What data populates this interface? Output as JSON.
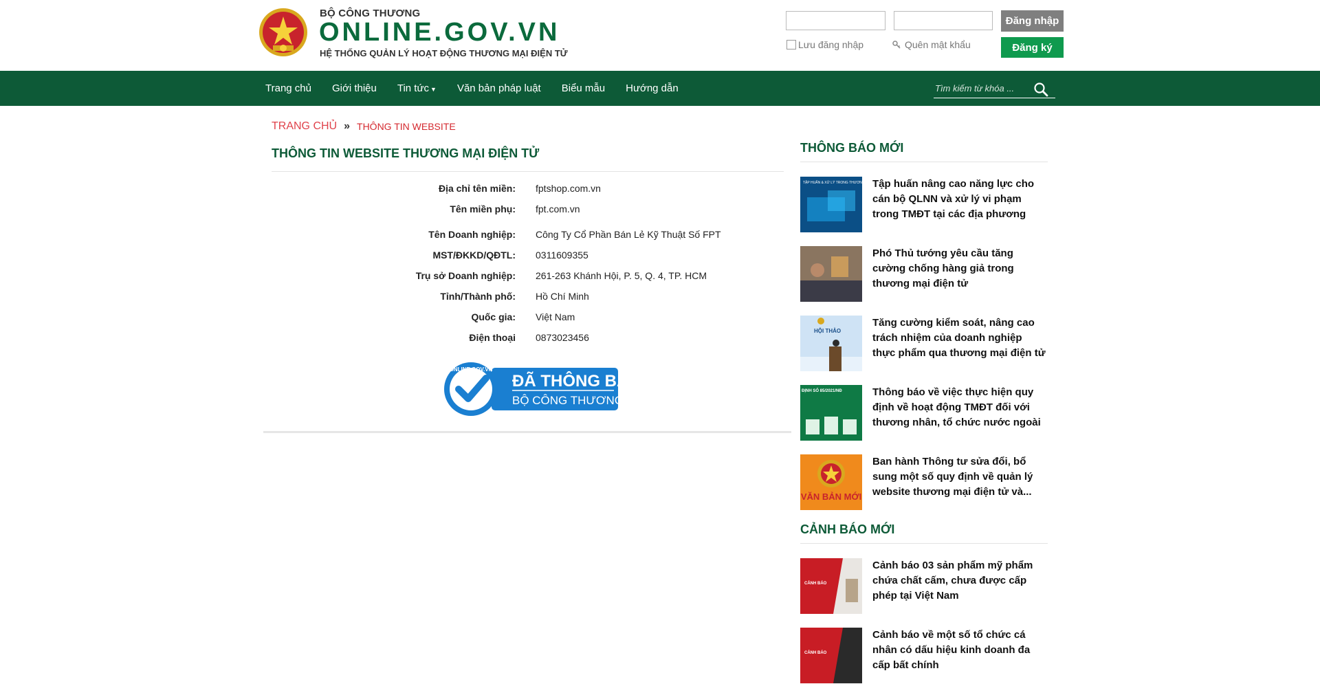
{
  "header": {
    "ministry": "BỘ CÔNG THƯƠNG",
    "site_name": "ONLINE.GOV.VN",
    "subtitle": "HỆ THỐNG QUẢN LÝ HOẠT ĐỘNG THƯƠNG MẠI ĐIỆN TỬ",
    "login_button": "Đăng nhập",
    "remember_label": "Lưu đăng nhập",
    "forgot_label": "Quên mật khẩu",
    "register_button": "Đăng ký",
    "username_value": "",
    "password_value": ""
  },
  "nav": {
    "items": [
      {
        "label": "Trang chủ"
      },
      {
        "label": "Giới thiệu"
      },
      {
        "label": "Tin tức"
      },
      {
        "label": "Văn bản pháp luật"
      },
      {
        "label": "Biểu mẫu"
      },
      {
        "label": "Hướng dẫn"
      }
    ],
    "search_placeholder": "Tìm kiếm từ khóa ...",
    "search_value": ""
  },
  "breadcrumb": {
    "home": "TRANG CHỦ",
    "separator": "»",
    "current": "THÔNG TIN WEBSITE"
  },
  "main": {
    "title": "THÔNG TIN WEBSITE THƯƠNG MẠI ĐIỆN TỬ",
    "fields": [
      {
        "label": "Địa chỉ tên miền:",
        "value": "fptshop.com.vn"
      },
      {
        "label": "Tên miền phụ:",
        "value": "fpt.com.vn"
      },
      {
        "label": "Tên Doanh nghiệp:",
        "value": "Công Ty Cổ Phần Bán Lẻ Kỹ Thuật Số FPT"
      },
      {
        "label": "MST/ĐKKD/QĐTL:",
        "value": "0311609355"
      },
      {
        "label": "Trụ sở Doanh nghiệp:",
        "value": "261-263 Khánh Hội, P. 5, Q. 4, TP. HCM"
      },
      {
        "label": "Tỉnh/Thành phố:",
        "value": "Hồ Chí Minh"
      },
      {
        "label": "Quốc gia:",
        "value": "Việt Nam"
      },
      {
        "label": "Điện thoại",
        "value": "0873023456"
      }
    ],
    "badge": {
      "circle_text": "ONLINE.GOV.VN",
      "line1": "ĐÃ THÔNG BÁO",
      "line2": "BỘ CÔNG THƯƠNG",
      "color": "#1a7fd1"
    }
  },
  "sidebar": {
    "notices_heading": "THÔNG BÁO MỚI",
    "notices": [
      {
        "title": "Tập huấn nâng cao năng lực cho cán bộ QLNN và xử lý vi phạm trong TMĐT tại các địa phương",
        "thumb_text": "TẬP HUẤN & XỬ LÝ TRONG THƯƠNG MẠI ĐIỆN TỬ"
      },
      {
        "title": "Phó Thủ tướng yêu cầu tăng cường chống hàng giả trong thương mại điện tử",
        "thumb_text": ""
      },
      {
        "title": "Tăng cường kiểm soát, nâng cao trách nhiệm của doanh nghiệp thực phẩm qua thương mại điện tử",
        "thumb_text": "HỘI THẢO"
      },
      {
        "title": "Thông báo về việc thực hiện quy định về hoạt động TMĐT đối với thương nhân, tổ chức nước ngoài",
        "thumb_text": "ĐỊNH SỐ 85/2021/NĐ"
      },
      {
        "title": "Ban hành Thông tư sửa đổi, bổ sung một số quy định về quản lý website thương mại điện tử và...",
        "thumb_text": "VĂN BẢN MỚI"
      }
    ],
    "warnings_heading": "CẢNH BÁO MỚI",
    "warnings": [
      {
        "title": "Cảnh báo 03 sản phẩm mỹ phẩm chứa chất cấm, chưa được cấp phép tại Việt Nam",
        "thumb_text": "CẢNH BÁO"
      },
      {
        "title": "Cảnh báo về một số tổ chức cá nhân có dấu hiệu kinh doanh đa cấp bất chính",
        "thumb_text": "CẢNH BÁO"
      }
    ]
  },
  "colors": {
    "brand_green": "#0b6a3c",
    "nav_green": "#0d5a37",
    "register_green": "#0f9a4e",
    "login_gray": "#7f7f7f",
    "breadcrumb_red": "#e0424b",
    "badge_blue": "#1a7fd1"
  }
}
